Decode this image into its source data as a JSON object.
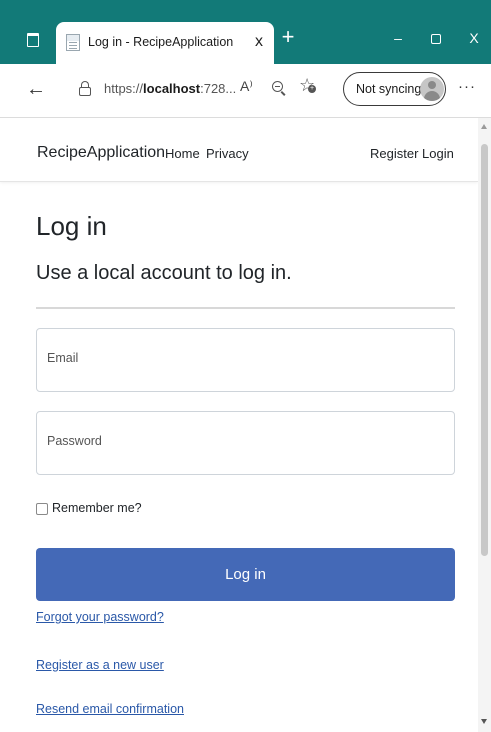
{
  "browser": {
    "tab": {
      "title": "Log in - RecipeApplication",
      "close": "x"
    },
    "new_tab": "+",
    "window": {
      "minimize": "–",
      "close": "X"
    },
    "address": {
      "url_prefix": "https://",
      "url_host": "localhost",
      "url_rest": ":728...",
      "read_aloud": "A⁾"
    },
    "profile": {
      "label": "Not syncing"
    },
    "more": "···",
    "back": "←",
    "favorites_icon": "☆"
  },
  "site_nav": {
    "brand": "RecipeApplication",
    "links": {
      "home": "Home",
      "privacy": "Privacy",
      "register": "Register",
      "login": "Login"
    }
  },
  "page": {
    "title": "Log in",
    "subtitle": "Use a local account to log in.",
    "email_label": "Email",
    "password_label": "Password",
    "remember_label": "Remember me?",
    "remember_checked": false,
    "submit_label": "Log in",
    "links": {
      "forgot": "Forgot your password?",
      "register": "Register as a new user",
      "resend": "Resend email confirmation"
    }
  },
  "colors": {
    "browser_accent": "#127a78",
    "primary_button": "#4469b7",
    "link": "#2a58a8"
  }
}
